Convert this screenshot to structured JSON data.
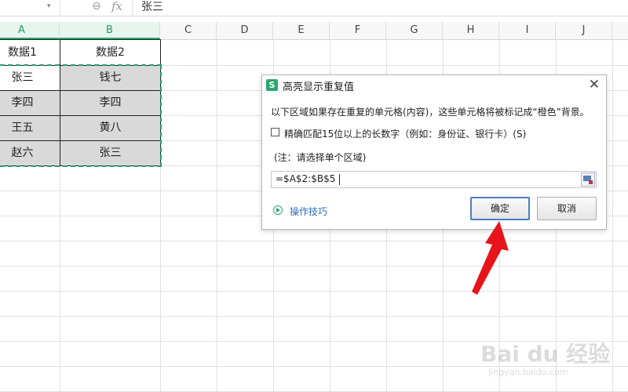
{
  "formula_bar": {
    "fx_label": "fx",
    "content": "张三"
  },
  "columns": [
    {
      "label": "A",
      "selected": true
    },
    {
      "label": "B",
      "selected": true
    },
    {
      "label": "C",
      "selected": false
    },
    {
      "label": "D",
      "selected": false
    },
    {
      "label": "E",
      "selected": false
    },
    {
      "label": "F",
      "selected": false
    },
    {
      "label": "G",
      "selected": false
    },
    {
      "label": "H",
      "selected": false
    },
    {
      "label": "I",
      "selected": false
    },
    {
      "label": "J",
      "selected": false
    }
  ],
  "table": {
    "headers": [
      "数据1",
      "数据2"
    ],
    "rows": [
      [
        "张三",
        "钱七"
      ],
      [
        "李四",
        "李四"
      ],
      [
        "王五",
        "黄八"
      ],
      [
        "赵六",
        "张三"
      ]
    ]
  },
  "dialog": {
    "logo": "S",
    "title": "高亮显示重复值",
    "close": "✕",
    "description": "以下区域如果存在重复的单元格(内容)，这些单元格将被标记成“橙色”背景。",
    "checkbox_label": "精确匹配15位以上的长数字（例如：身份证、银行卡）(S)",
    "note": "(注：请选择单个区域)",
    "range_value": "=$A$2:$B$5",
    "tips_link": "操作技巧",
    "ok_button": "确定",
    "cancel_button": "取消"
  },
  "watermark": {
    "main": "Bai du 经验",
    "sub": "jingyan.baidu.com"
  },
  "colors": {
    "accent_green": "#2aa86e",
    "arrow_red": "#e8141b",
    "selected_fill": "#d9d9d9",
    "link_blue": "#2e6fb8"
  }
}
